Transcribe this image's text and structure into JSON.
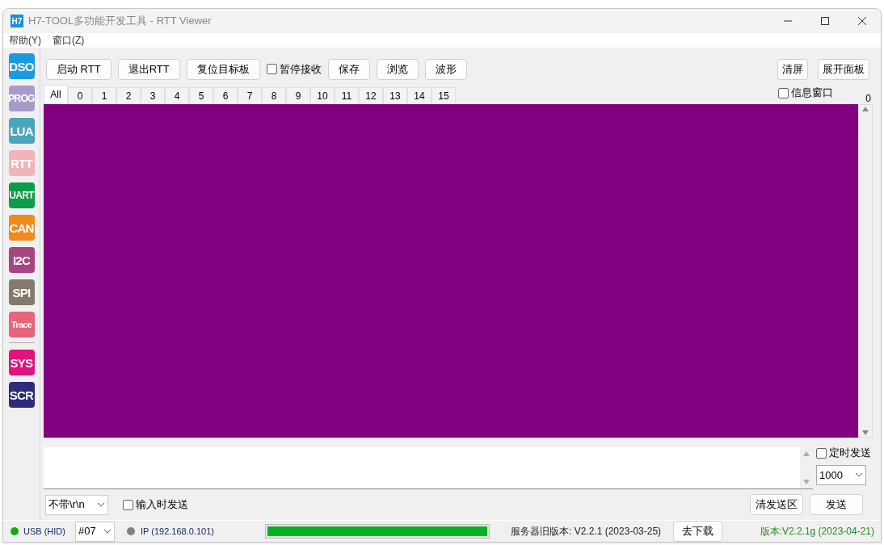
{
  "window": {
    "title": "H7-TOOL多功能开发工具 - RTT Viewer",
    "app_badge": "H7"
  },
  "menu": [
    "帮助(Y)",
    "窗口(Z)"
  ],
  "sidebar": {
    "groups": [
      [
        {
          "label": "DSO",
          "color": "#1a9be0"
        },
        {
          "label": "PROG",
          "color": "#a99bc9"
        },
        {
          "label": "LUA",
          "color": "#4aa5bd"
        },
        {
          "label": "RTT",
          "color": "#f2b3bc"
        },
        {
          "label": "UART",
          "color": "#0d9b4c"
        },
        {
          "label": "CAN",
          "color": "#ef8a1c"
        },
        {
          "label": "I2C",
          "color": "#a6457f"
        },
        {
          "label": "SPI",
          "color": "#827a6c"
        },
        {
          "label": "Trace",
          "color": "#e8637c"
        }
      ],
      [
        {
          "label": "SYS",
          "color": "#e2127f"
        },
        {
          "label": "SCR",
          "color": "#2e2a7c"
        }
      ]
    ]
  },
  "toolbar": {
    "left": [
      {
        "kind": "button",
        "label": "启动 RTT"
      },
      {
        "kind": "button",
        "label": "退出RTT"
      },
      {
        "kind": "button",
        "label": "复位目标板"
      },
      {
        "kind": "checkbox",
        "label": "暂停接收",
        "checked": false
      },
      {
        "kind": "button",
        "label": "保存"
      },
      {
        "kind": "button",
        "label": "浏览"
      },
      {
        "kind": "button",
        "label": "波形"
      }
    ],
    "right": [
      "清屏",
      "展开面板"
    ]
  },
  "channel_tabs": [
    {
      "label": "All",
      "selected": true
    },
    {
      "label": "0",
      "selected": false
    },
    {
      "label": "1",
      "selected": false
    },
    {
      "label": "2",
      "selected": false
    },
    {
      "label": "3",
      "selected": false
    },
    {
      "label": "4",
      "selected": false
    },
    {
      "label": "5",
      "selected": false
    },
    {
      "label": "6",
      "selected": false
    },
    {
      "label": "7",
      "selected": false
    },
    {
      "label": "8",
      "selected": false
    },
    {
      "label": "9",
      "selected": false
    },
    {
      "label": "10",
      "selected": false
    },
    {
      "label": "11",
      "selected": false
    },
    {
      "label": "12",
      "selected": false
    },
    {
      "label": "13",
      "selected": false
    },
    {
      "label": "14",
      "selected": false
    },
    {
      "label": "15",
      "selected": false
    }
  ],
  "info_window": {
    "label": "信息窗口",
    "checked": false
  },
  "counter": "0",
  "send": {
    "timed_send": {
      "label": "定时发送",
      "checked": false
    },
    "interval": "1000",
    "line_ending": "不带\\r\\n",
    "send_on_input": {
      "label": "输入时发送",
      "checked": false
    },
    "buttons": [
      "清发送区",
      "发送"
    ]
  },
  "status_bar": {
    "usb": {
      "label": "USB (HID)",
      "color": "#1aa51a"
    },
    "device": "#07",
    "ip": {
      "label": "IP (192.168.0.101)",
      "color": "#808080"
    },
    "progress": {
      "level": 1.0
    },
    "server_version": "服务器旧版本: V2.2.1 (2023-03-25)",
    "download_button": "去下载",
    "version": "版本:V2.2.1g (2023-04-21)"
  }
}
